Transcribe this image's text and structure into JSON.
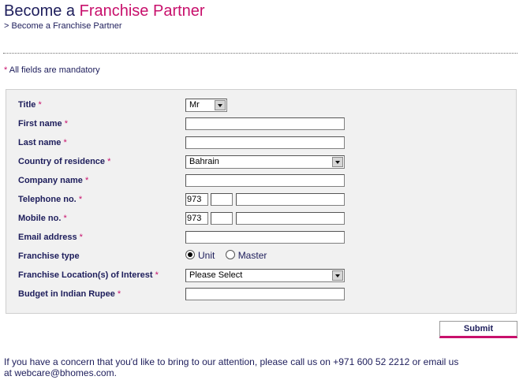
{
  "header": {
    "title_prefix": "Become a ",
    "title_accent": "Franchise Partner",
    "breadcrumb": "> Become a Franchise Partner"
  },
  "notice": {
    "star": "*",
    "text": " All fields are mandatory"
  },
  "form": {
    "required_mark": "*",
    "title": {
      "label": "Title",
      "value": "Mr"
    },
    "first_name": {
      "label": "First name",
      "value": ""
    },
    "last_name": {
      "label": "Last name",
      "value": ""
    },
    "country": {
      "label": "Country of residence",
      "value": "Bahrain"
    },
    "company": {
      "label": "Company name",
      "value": ""
    },
    "telephone": {
      "label": "Telephone no.",
      "code": "973",
      "area": "",
      "number": ""
    },
    "mobile": {
      "label": "Mobile no.",
      "code": "973",
      "area": "",
      "number": ""
    },
    "email": {
      "label": "Email address",
      "value": ""
    },
    "franchise_type": {
      "label": "Franchise type",
      "options": [
        "Unit",
        "Master"
      ],
      "selected": "Unit"
    },
    "location": {
      "label": "Franchise Location(s) of Interest",
      "value": "Please Select"
    },
    "budget": {
      "label": "Budget in Indian Rupee",
      "value": ""
    }
  },
  "submit_label": "Submit",
  "footer": {
    "text_1": "If you have a concern that you'd like to bring to our attention, please call us on +971 600 52 2212 or email us",
    "text_2": "at ",
    "email": "webcare@bhomes.com",
    "text_3": "."
  },
  "colors": {
    "accent": "#c8106c",
    "text": "#1d1d5b",
    "form_bg": "#f1f1f1"
  }
}
